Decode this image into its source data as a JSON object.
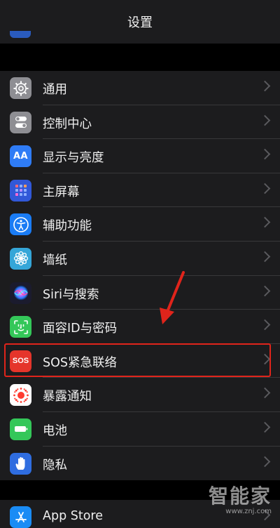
{
  "nav": {
    "title": "设置"
  },
  "settings": {
    "items": [
      {
        "label": "通用",
        "icon": "gear-icon",
        "color": "#8e8e93"
      },
      {
        "label": "控制中心",
        "icon": "toggles-icon",
        "color": "#8e8e93"
      },
      {
        "label": "显示与亮度",
        "icon": "text-size-icon",
        "color": "#2f7cf6",
        "glyph": "AA"
      },
      {
        "label": "主屏幕",
        "icon": "home-grid-icon",
        "color": "#3158d8"
      },
      {
        "label": "辅助功能",
        "icon": "accessibility-icon",
        "color": "#1a7cf5"
      },
      {
        "label": "墙纸",
        "icon": "flower-icon",
        "color": "#35a6d8"
      },
      {
        "label": "Siri与搜索",
        "icon": "siri-icon",
        "color": "#1b1b2e"
      },
      {
        "label": "面容ID与密码",
        "icon": "face-id-icon",
        "color": "#34c759"
      },
      {
        "label": "SOS紧急联络",
        "icon": "sos-icon",
        "color": "#e5352b",
        "glyph": "SOS"
      },
      {
        "label": "暴露通知",
        "icon": "exposure-icon",
        "color": "#ffffff"
      },
      {
        "label": "电池",
        "icon": "battery-icon",
        "color": "#34c759"
      },
      {
        "label": "隐私",
        "icon": "hand-icon",
        "color": "#2f6de0"
      }
    ]
  },
  "group2": {
    "items": [
      {
        "label": "App Store",
        "icon": "app-store-icon",
        "color": "#1a8cf5"
      }
    ]
  },
  "watermark": {
    "brand": "智能家",
    "url": "www.znj.com"
  },
  "accent": {
    "highlight": "#e0241b"
  }
}
